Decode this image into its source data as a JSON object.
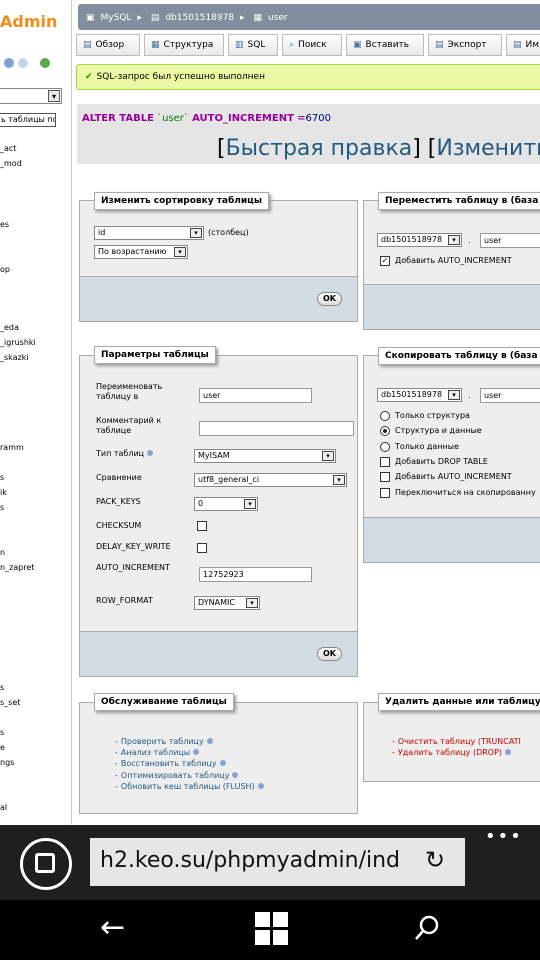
{
  "sidebar": {
    "logo": "Admin",
    "db_select": "",
    "filter_placeholder": "ь таблицы по",
    "items": [
      "_act",
      "_mod",
      "es",
      "op",
      "_eda",
      "_igrushki",
      "_skazki",
      "ramm",
      "s",
      "ik",
      "s",
      "n",
      "n_zapret",
      "s",
      "s_set",
      "s",
      "e",
      "ngs",
      "al"
    ]
  },
  "breadcrumb": [
    "MySQL",
    "db1501518978",
    "user"
  ],
  "tabs": [
    {
      "icon": "browse-icon",
      "label": "Обзор"
    },
    {
      "icon": "structure-icon",
      "label": "Структура"
    },
    {
      "icon": "sql-icon",
      "label": "SQL"
    },
    {
      "icon": "search-icon",
      "label": "Поиск"
    },
    {
      "icon": "insert-icon",
      "label": "Вставить"
    },
    {
      "icon": "export-icon",
      "label": "Экспорт"
    },
    {
      "icon": "import-icon",
      "label": "Им"
    }
  ],
  "success_message": "SQL-запрос был успешно выполнен",
  "sql": {
    "keyword": "ALTER TABLE",
    "table": "`user`",
    "option": "AUTO_INCREMENT",
    "eq": "=",
    "value": "6700",
    "open1": "[",
    "quick_edit": "Быстрая правка",
    "mid": "] [",
    "edit": "Изменить",
    "close": "]"
  },
  "sort": {
    "legend": "Изменить сортировку таблицы",
    "column": "id",
    "column_suffix": "(столбец)",
    "order": "По возрастанию",
    "ok": "OK"
  },
  "move": {
    "legend": "Переместить таблицу в (база да",
    "db": "db1501518978",
    "dot": ".",
    "table": "user",
    "auto_increment_label": "Добавить AUTO_INCREMENT",
    "auto_increment_checked": true
  },
  "params": {
    "legend": "Параметры таблицы",
    "rename_label": "Переименовать таблицу в",
    "rename_value": "user",
    "comment_label": "Комментарий к таблице",
    "comment_value": "",
    "type_label": "Тип таблиц",
    "type_value": "MyISAM",
    "collation_label": "Сравнение",
    "collation_value": "utf8_general_ci",
    "pack_keys_label": "PACK_KEYS",
    "pack_keys_value": "0",
    "checksum_label": "CHECKSUM",
    "delay_key_write_label": "DELAY_KEY_WRITE",
    "auto_increment_label": "AUTO_INCREMENT",
    "auto_increment_value": "12752923",
    "row_format_label": "ROW_FORMAT",
    "row_format_value": "DYNAMIC",
    "ok": "OK"
  },
  "copy": {
    "legend": "Скопировать таблицу в (база да",
    "db": "db1501518978",
    "dot": ".",
    "table": "user",
    "options": [
      "Только структура",
      "Структура и данные",
      "Только данные"
    ],
    "selected_option": 1,
    "checkboxes": [
      "Добавить DROP TABLE",
      "Добавить AUTO_INCREMENT",
      "Переключиться на скопированну"
    ]
  },
  "maintenance": {
    "legend": "Обслуживание таблицы",
    "links": [
      "Проверить таблицу",
      "Анализ таблицы",
      "Восстановить таблицу",
      "Оптимизировать таблицу",
      "Обновить кеш таблицы (FLUSH)"
    ]
  },
  "delete": {
    "legend": "Удалить данные или таблицу",
    "links": [
      "Очистить таблицу (TRUNCATI",
      "Удалить таблицу (DROP)"
    ]
  },
  "browser": {
    "url": "h2.keo.su/phpmyadmin/ind",
    "more": "•••"
  },
  "colors": {
    "accent": "#235a81",
    "logo": "#f28c1c",
    "success_bg": "#ebf8a4",
    "danger": "#cc0000"
  }
}
